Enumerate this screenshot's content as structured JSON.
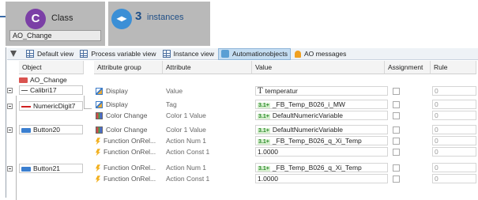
{
  "header": {
    "class_tile": {
      "badge": "C",
      "label": "Class",
      "input_value": "AO_Change"
    },
    "instances_tile": {
      "badge": "◂▸",
      "count": "3",
      "label": "instances"
    }
  },
  "toolbar": {
    "items": [
      {
        "label": "Default view"
      },
      {
        "label": "Process variable view"
      },
      {
        "label": "Instance view"
      },
      {
        "label": "Automationobjects"
      },
      {
        "label": "AO messages"
      }
    ]
  },
  "grid": {
    "columns": {
      "object": "Object",
      "attribute_group": "Attribute group",
      "attribute": "Attribute",
      "value": "Value",
      "assignment": "Assignment",
      "rule": "Rule"
    },
    "root": "AO_Change",
    "objects": [
      {
        "name": "Calibri17",
        "icon": "dash-icon"
      },
      {
        "name": "NumericDigit7",
        "icon": "numeric-digit-icon"
      },
      {
        "name": "Button20",
        "icon": "button-icon"
      },
      {
        "name": "Button21",
        "icon": "button-icon"
      }
    ],
    "rows": [
      {
        "group": "Display",
        "icon": "display-icon",
        "attribute": "Value",
        "value_icon": "T",
        "value": "temperatur",
        "rule": "0"
      },
      {
        "group": "Display",
        "icon": "display-icon",
        "attribute": "Tag",
        "value_icon": "3.1+",
        "value": "_FB_Temp_B026_i_MW",
        "rule": "0"
      },
      {
        "group": "Color Change",
        "icon": "color-change-icon",
        "attribute": "Color 1 Value",
        "value_icon": "3.1+",
        "value": "DefaultNumericVariable",
        "rule": "0"
      },
      {
        "group": "Color Change",
        "icon": "color-change-icon",
        "attribute": "Color 1 Value",
        "value_icon": "3.1+",
        "value": "DefaultNumericVariable",
        "rule": "0"
      },
      {
        "group": "Function OnRel...",
        "icon": "function-icon",
        "attribute": "Action Num 1",
        "value_icon": "3.1+",
        "value": "_FB_Temp_B026_q_Xi_Temp",
        "rule": "0"
      },
      {
        "group": "Function OnRel...",
        "icon": "function-icon",
        "attribute": "Action Const 1",
        "value_icon": "",
        "value": "1.0000",
        "rule": "0"
      },
      {
        "group": "Function OnRel...",
        "icon": "function-icon",
        "attribute": "Action Num 1",
        "value_icon": "3.1+",
        "value": "_FB_Temp_B026_q_Xi_Temp",
        "rule": "0"
      },
      {
        "group": "Function OnRel...",
        "icon": "function-icon",
        "attribute": "Action Const 1",
        "value_icon": "",
        "value": "1.0000",
        "rule": "0"
      }
    ]
  }
}
